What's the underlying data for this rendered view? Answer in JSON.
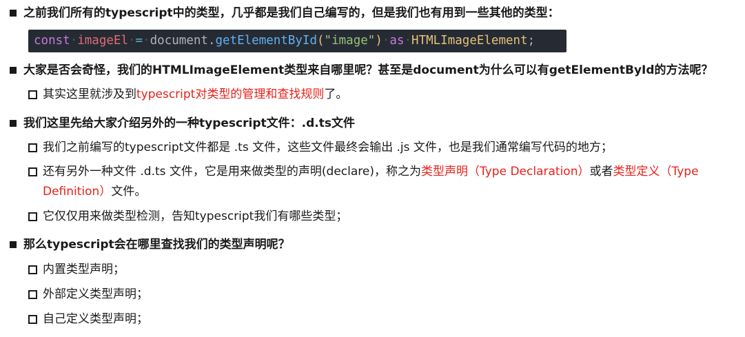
{
  "items": [
    {
      "kind": "main",
      "text": "之前我们所有的typescript中的类型，几乎都是我们自己编写的，但是我们也有用到一些其他的类型："
    },
    {
      "kind": "main",
      "text": "大家是否会奇怪，我们的HTMLImageElement类型来自哪里呢？甚至是document为什么可以有getElementById的方法呢？"
    },
    {
      "kind": "sub",
      "prefix": "其实这里就涉及到",
      "highlight": "typescript对类型的管理和查找规则",
      "suffix": "了。"
    },
    {
      "kind": "main",
      "text": "我们这里先给大家介绍另外的一种typescript文件：.d.ts文件"
    },
    {
      "kind": "sub",
      "text": "我们之前编写的typescript文件都是 .ts 文件，这些文件最终会输出 .js 文件，也是我们通常编写代码的地方；"
    },
    {
      "kind": "sub",
      "part1": "还有另外一种文件 .d.ts 文件，它是用来做类型的声明(declare)，称之为",
      "hl1": "类型声明（Type Declaration）",
      "part2": "或者",
      "hl2": "类型定义（Type Definition）",
      "part3": "文件。"
    },
    {
      "kind": "sub",
      "text": "它仅仅用来做类型检测，告知typescript我们有哪些类型；"
    },
    {
      "kind": "main",
      "text": "那么typescript会在哪里查找我们的类型声明呢？"
    },
    {
      "kind": "sub",
      "text": "内置类型声明；"
    },
    {
      "kind": "sub",
      "text": "外部定义类型声明；"
    },
    {
      "kind": "sub",
      "text": "自己定义类型声明；"
    }
  ],
  "code": {
    "kw": "const",
    "var": "imageEl",
    "op": "=",
    "obj": "document",
    "dot": ".",
    "fn": "getElementById",
    "lparen": "(",
    "str": "\"image\"",
    "rparen": ")",
    "as": "as",
    "type": "HTMLImageElement",
    "semi": ";"
  },
  "colors": {
    "highlight": "#e8201a",
    "code_bg": "#262b33"
  }
}
